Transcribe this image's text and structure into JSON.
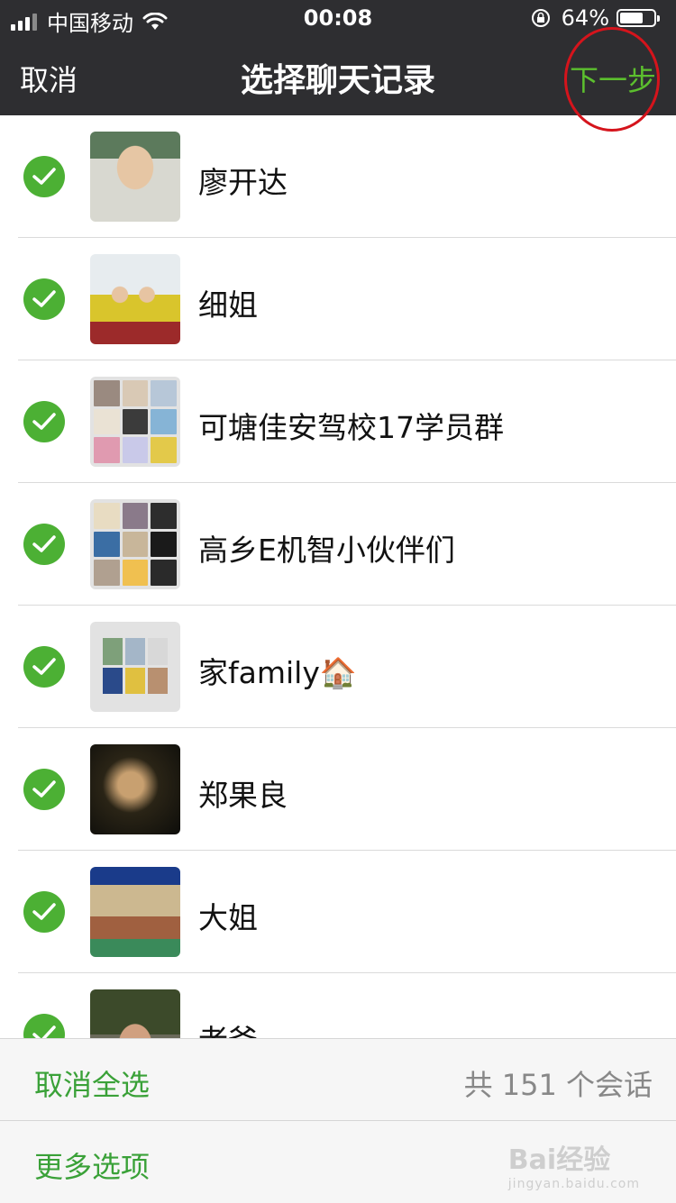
{
  "status_bar": {
    "carrier": "中国移动",
    "time": "00:08",
    "battery_percent": "64%",
    "battery_level": 0.64
  },
  "nav": {
    "cancel_label": "取消",
    "title": "选择聊天记录",
    "next_label": "下一步"
  },
  "chats": [
    {
      "name": "廖开达",
      "selected": true,
      "avatar": "person-photo"
    },
    {
      "name": "细姐",
      "selected": true,
      "avatar": "kids-photo"
    },
    {
      "name": "可塘佳安驾校17学员群",
      "selected": true,
      "avatar": "group-grid"
    },
    {
      "name": "高乡E机智小伙伴们",
      "selected": true,
      "avatar": "group-grid"
    },
    {
      "name": "家family🏠",
      "selected": true,
      "avatar": "group-grid"
    },
    {
      "name": "郑果良",
      "selected": true,
      "avatar": "person-photo"
    },
    {
      "name": "大姐",
      "selected": true,
      "avatar": "shop-photo"
    },
    {
      "name": "老爸",
      "selected": true,
      "avatar": "person-photo"
    }
  ],
  "toolbar": {
    "deselect_all_label": "取消全选",
    "count_label": "共 151 个会话",
    "more_options_label": "更多选项"
  },
  "watermark": {
    "text": "Bai经验",
    "sub": "jingyan.baidu.com"
  },
  "colors": {
    "accent_green": "#4cb034",
    "nav_bg": "#2e2e31",
    "annotation_red": "#d5141c"
  }
}
